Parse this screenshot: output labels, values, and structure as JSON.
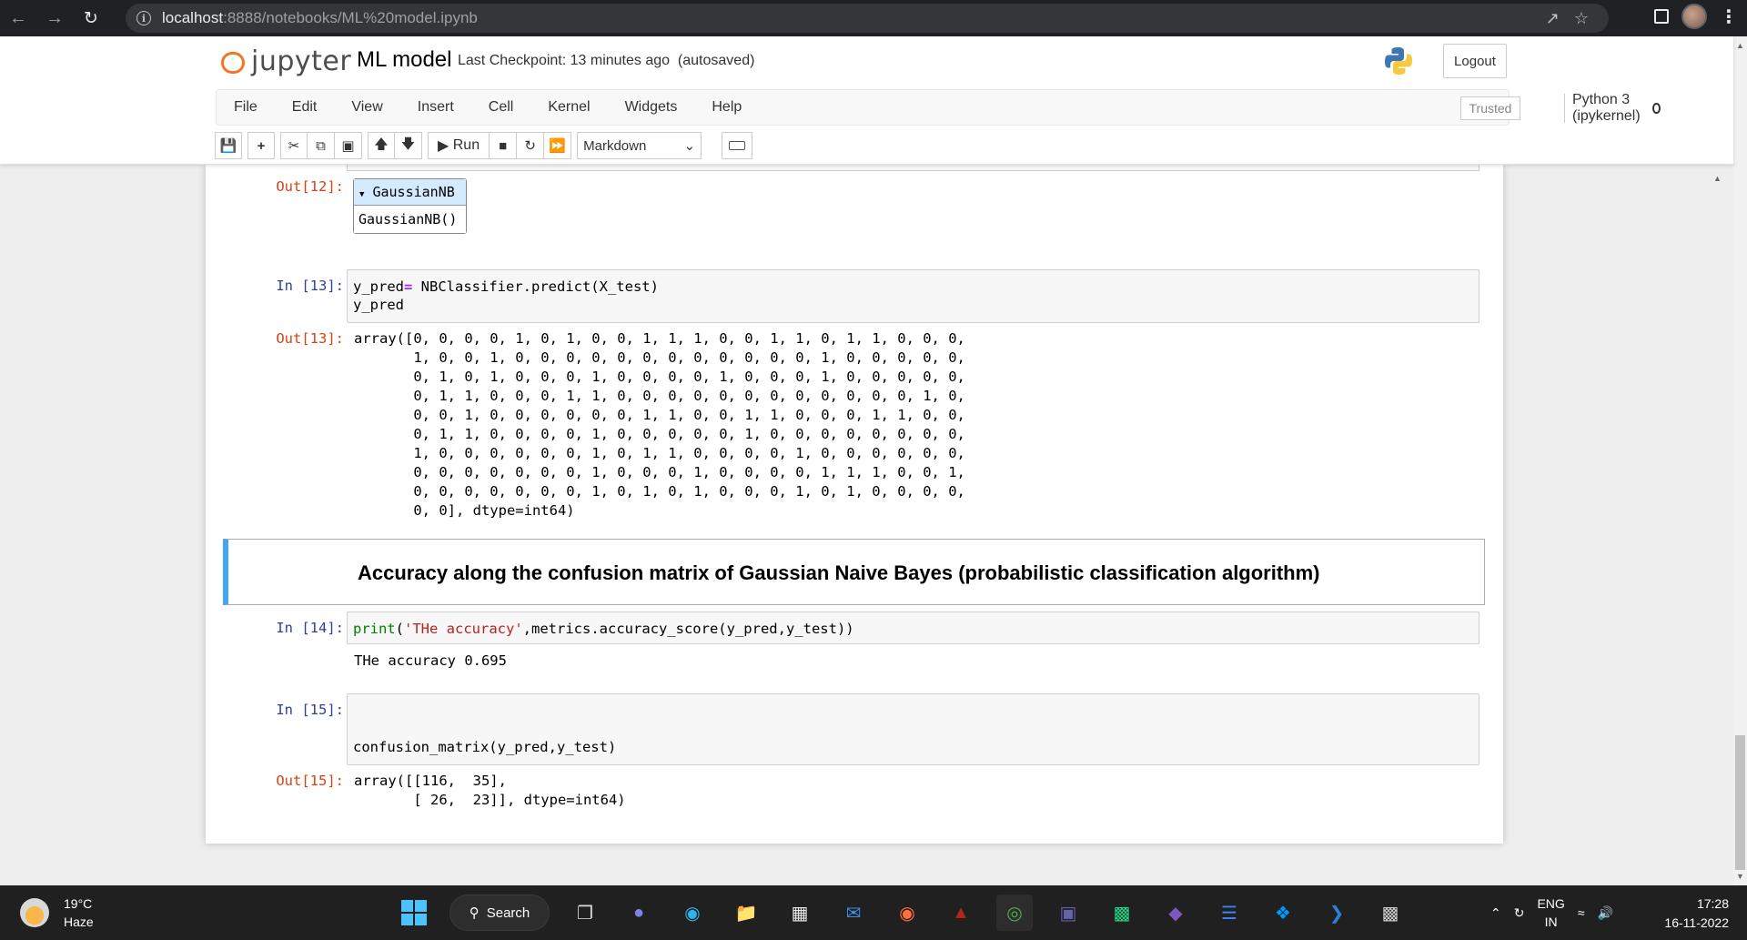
{
  "browser": {
    "url_host": "localhost",
    "url_path": ":8888/notebooks/ML%20model.ipynb"
  },
  "header": {
    "logo_text": "jupyter",
    "notebook_name": "ML model",
    "checkpoint": "Last Checkpoint: 13 minutes ago",
    "autosaved": "(autosaved)",
    "logout_label": "Logout"
  },
  "menu": {
    "items": [
      "File",
      "Edit",
      "View",
      "Insert",
      "Cell",
      "Kernel",
      "Widgets",
      "Help"
    ],
    "trusted": "Trusted",
    "kernel": "Python 3 (ipykernel)"
  },
  "toolbar": {
    "run_label": "Run",
    "cell_type": "Markdown"
  },
  "cells": {
    "out12": {
      "prompt": "Out[12]:",
      "estimator_name": "GaussianNB",
      "estimator_repr": "GaussianNB()"
    },
    "in13": {
      "prompt": "In [13]:",
      "line1_a": "y_pred",
      "line1_eq": "=",
      "line1_b": " NBClassifier.predict(X_test)",
      "line2": "y_pred"
    },
    "out13": {
      "prompt": "Out[13]:",
      "text": "array([0, 0, 0, 0, 1, 0, 1, 0, 0, 1, 1, 1, 0, 0, 1, 1, 0, 1, 1, 0, 0, 0,\n       1, 0, 0, 1, 0, 0, 0, 0, 0, 0, 0, 0, 0, 0, 0, 0, 1, 0, 0, 0, 0, 0,\n       0, 1, 0, 1, 0, 0, 0, 1, 0, 0, 0, 0, 1, 0, 0, 0, 1, 0, 0, 0, 0, 0,\n       0, 1, 1, 0, 0, 0, 1, 1, 0, 0, 0, 0, 0, 0, 0, 0, 0, 0, 0, 0, 1, 0,\n       0, 0, 1, 0, 0, 0, 0, 0, 0, 1, 1, 0, 0, 1, 1, 0, 0, 0, 1, 1, 0, 0,\n       0, 1, 1, 0, 0, 0, 0, 1, 0, 0, 0, 0, 0, 1, 0, 0, 0, 0, 0, 0, 0, 0,\n       1, 0, 0, 0, 0, 0, 0, 1, 0, 1, 1, 0, 0, 0, 0, 1, 0, 0, 0, 0, 0, 0,\n       0, 0, 0, 0, 0, 0, 0, 1, 0, 0, 0, 1, 0, 0, 0, 0, 1, 1, 1, 0, 0, 1,\n       0, 0, 0, 0, 0, 0, 0, 1, 0, 1, 0, 1, 0, 0, 0, 1, 0, 1, 0, 0, 0, 0,\n       0, 0], dtype=int64)"
    },
    "markdown": {
      "title": "Accuracy along the confusion matrix of Gaussian Naive Bayes (probabilistic classification algorithm)"
    },
    "in14": {
      "prompt": "In [14]:",
      "fn": "print",
      "open": "(",
      "str": "'THe accuracy'",
      "rest": ",metrics.accuracy_score(y_pred,y_test))"
    },
    "out14": {
      "text": "THe accuracy 0.695"
    },
    "in15": {
      "prompt": "In [15]:",
      "code": "confusion_matrix(y_pred,y_test)"
    },
    "out15": {
      "prompt": "Out[15]:",
      "text": "array([[116,  35],\n       [ 26,  23]], dtype=int64)"
    }
  },
  "taskbar": {
    "temperature": "19°C",
    "weather": "Haze",
    "search_label": "Search",
    "lang_top": "ENG",
    "lang_bottom": "IN",
    "time": "17:28",
    "date": "16-11-2022"
  }
}
